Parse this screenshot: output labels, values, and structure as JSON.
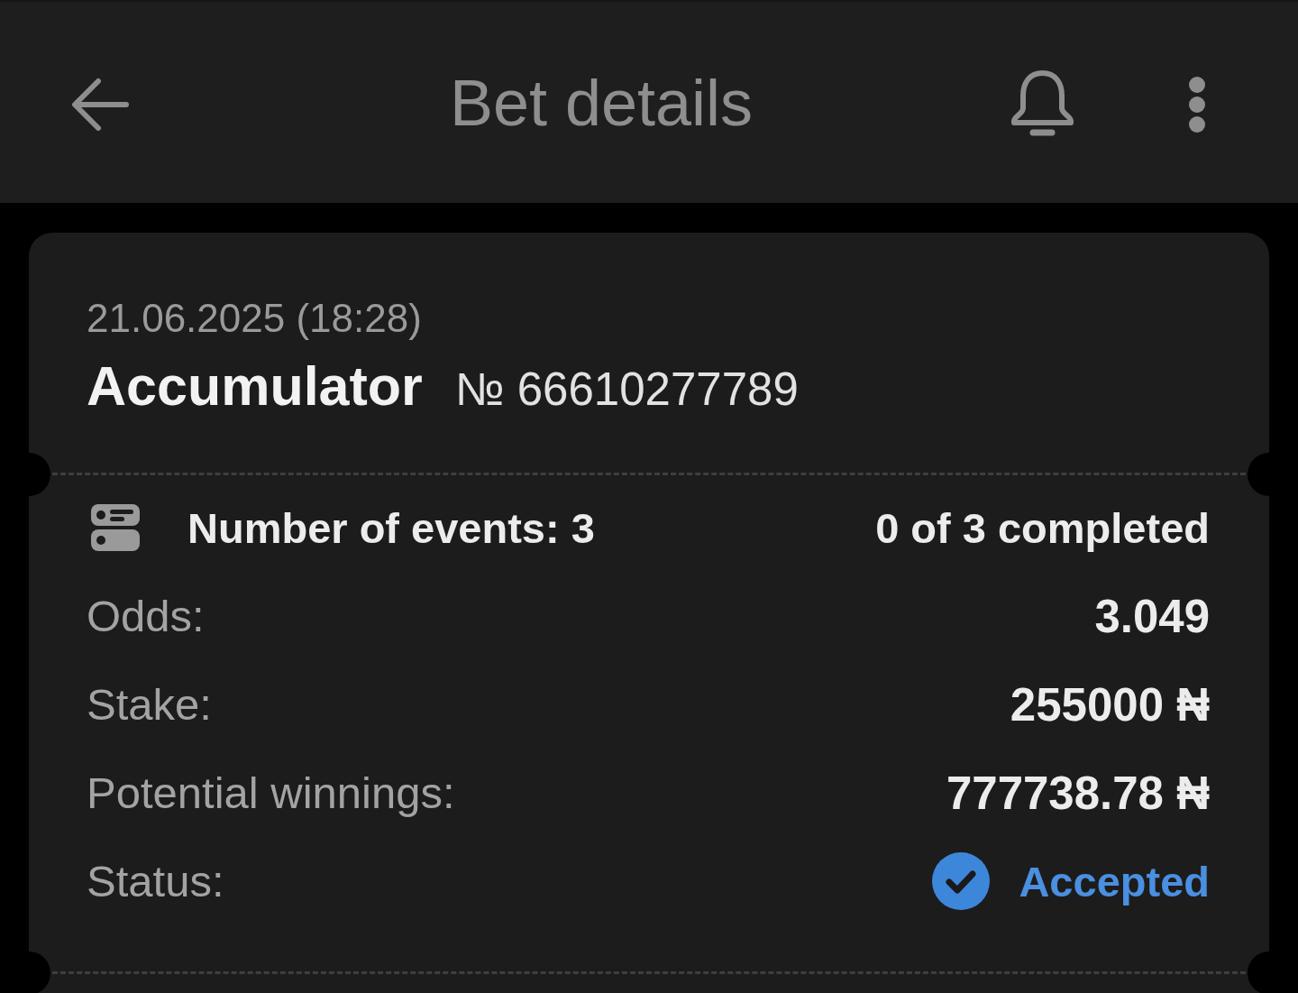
{
  "header": {
    "title": "Bet details"
  },
  "bet": {
    "date": "21.06.2025 (18:28)",
    "type": "Accumulator",
    "number": "№ 66610277789"
  },
  "summary": {
    "events": "Number of events: 3",
    "completed": "0 of 3 completed"
  },
  "details": [
    {
      "kind": "amount",
      "label": "Odds:",
      "value": "3.049"
    },
    {
      "kind": "amount",
      "label": "Stake:",
      "value": "255000 ₦"
    },
    {
      "kind": "amount",
      "label": "Potential winnings:",
      "value": "777738.78 ₦"
    },
    {
      "kind": "status",
      "label": "Status:",
      "value": "Accepted"
    }
  ]
}
